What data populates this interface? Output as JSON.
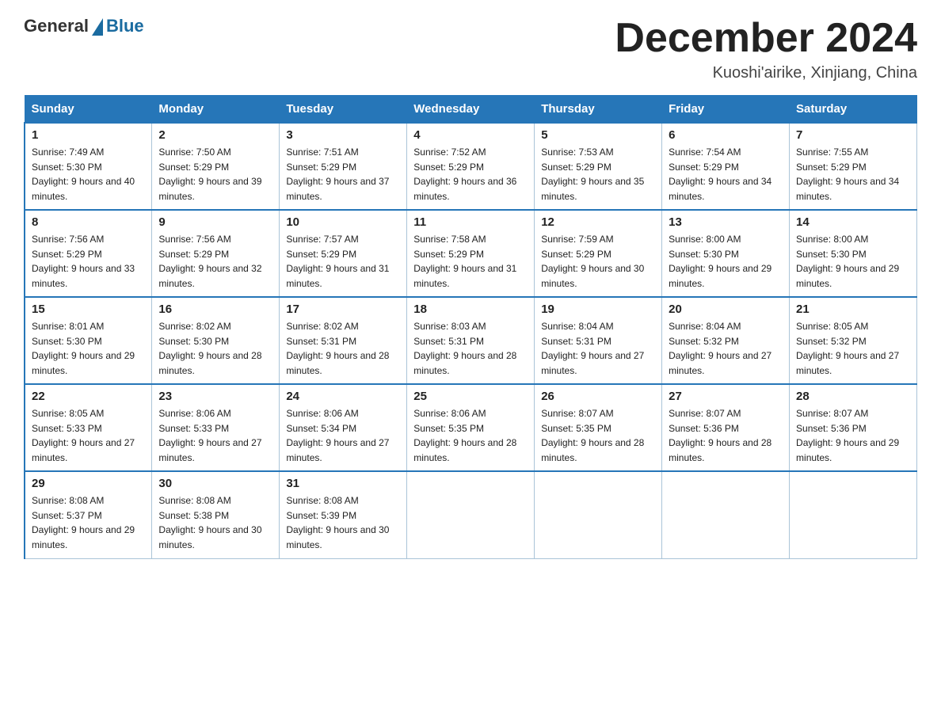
{
  "header": {
    "logo_general": "General",
    "logo_blue": "Blue",
    "title": "December 2024",
    "subtitle": "Kuoshi'airike, Xinjiang, China"
  },
  "weekdays": [
    "Sunday",
    "Monday",
    "Tuesday",
    "Wednesday",
    "Thursday",
    "Friday",
    "Saturday"
  ],
  "weeks": [
    [
      {
        "day": "1",
        "sunrise": "7:49 AM",
        "sunset": "5:30 PM",
        "daylight": "9 hours and 40 minutes."
      },
      {
        "day": "2",
        "sunrise": "7:50 AM",
        "sunset": "5:29 PM",
        "daylight": "9 hours and 39 minutes."
      },
      {
        "day": "3",
        "sunrise": "7:51 AM",
        "sunset": "5:29 PM",
        "daylight": "9 hours and 37 minutes."
      },
      {
        "day": "4",
        "sunrise": "7:52 AM",
        "sunset": "5:29 PM",
        "daylight": "9 hours and 36 minutes."
      },
      {
        "day": "5",
        "sunrise": "7:53 AM",
        "sunset": "5:29 PM",
        "daylight": "9 hours and 35 minutes."
      },
      {
        "day": "6",
        "sunrise": "7:54 AM",
        "sunset": "5:29 PM",
        "daylight": "9 hours and 34 minutes."
      },
      {
        "day": "7",
        "sunrise": "7:55 AM",
        "sunset": "5:29 PM",
        "daylight": "9 hours and 34 minutes."
      }
    ],
    [
      {
        "day": "8",
        "sunrise": "7:56 AM",
        "sunset": "5:29 PM",
        "daylight": "9 hours and 33 minutes."
      },
      {
        "day": "9",
        "sunrise": "7:56 AM",
        "sunset": "5:29 PM",
        "daylight": "9 hours and 32 minutes."
      },
      {
        "day": "10",
        "sunrise": "7:57 AM",
        "sunset": "5:29 PM",
        "daylight": "9 hours and 31 minutes."
      },
      {
        "day": "11",
        "sunrise": "7:58 AM",
        "sunset": "5:29 PM",
        "daylight": "9 hours and 31 minutes."
      },
      {
        "day": "12",
        "sunrise": "7:59 AM",
        "sunset": "5:29 PM",
        "daylight": "9 hours and 30 minutes."
      },
      {
        "day": "13",
        "sunrise": "8:00 AM",
        "sunset": "5:30 PM",
        "daylight": "9 hours and 29 minutes."
      },
      {
        "day": "14",
        "sunrise": "8:00 AM",
        "sunset": "5:30 PM",
        "daylight": "9 hours and 29 minutes."
      }
    ],
    [
      {
        "day": "15",
        "sunrise": "8:01 AM",
        "sunset": "5:30 PM",
        "daylight": "9 hours and 29 minutes."
      },
      {
        "day": "16",
        "sunrise": "8:02 AM",
        "sunset": "5:30 PM",
        "daylight": "9 hours and 28 minutes."
      },
      {
        "day": "17",
        "sunrise": "8:02 AM",
        "sunset": "5:31 PM",
        "daylight": "9 hours and 28 minutes."
      },
      {
        "day": "18",
        "sunrise": "8:03 AM",
        "sunset": "5:31 PM",
        "daylight": "9 hours and 28 minutes."
      },
      {
        "day": "19",
        "sunrise": "8:04 AM",
        "sunset": "5:31 PM",
        "daylight": "9 hours and 27 minutes."
      },
      {
        "day": "20",
        "sunrise": "8:04 AM",
        "sunset": "5:32 PM",
        "daylight": "9 hours and 27 minutes."
      },
      {
        "day": "21",
        "sunrise": "8:05 AM",
        "sunset": "5:32 PM",
        "daylight": "9 hours and 27 minutes."
      }
    ],
    [
      {
        "day": "22",
        "sunrise": "8:05 AM",
        "sunset": "5:33 PM",
        "daylight": "9 hours and 27 minutes."
      },
      {
        "day": "23",
        "sunrise": "8:06 AM",
        "sunset": "5:33 PM",
        "daylight": "9 hours and 27 minutes."
      },
      {
        "day": "24",
        "sunrise": "8:06 AM",
        "sunset": "5:34 PM",
        "daylight": "9 hours and 27 minutes."
      },
      {
        "day": "25",
        "sunrise": "8:06 AM",
        "sunset": "5:35 PM",
        "daylight": "9 hours and 28 minutes."
      },
      {
        "day": "26",
        "sunrise": "8:07 AM",
        "sunset": "5:35 PM",
        "daylight": "9 hours and 28 minutes."
      },
      {
        "day": "27",
        "sunrise": "8:07 AM",
        "sunset": "5:36 PM",
        "daylight": "9 hours and 28 minutes."
      },
      {
        "day": "28",
        "sunrise": "8:07 AM",
        "sunset": "5:36 PM",
        "daylight": "9 hours and 29 minutes."
      }
    ],
    [
      {
        "day": "29",
        "sunrise": "8:08 AM",
        "sunset": "5:37 PM",
        "daylight": "9 hours and 29 minutes."
      },
      {
        "day": "30",
        "sunrise": "8:08 AM",
        "sunset": "5:38 PM",
        "daylight": "9 hours and 30 minutes."
      },
      {
        "day": "31",
        "sunrise": "8:08 AM",
        "sunset": "5:39 PM",
        "daylight": "9 hours and 30 minutes."
      },
      null,
      null,
      null,
      null
    ]
  ]
}
